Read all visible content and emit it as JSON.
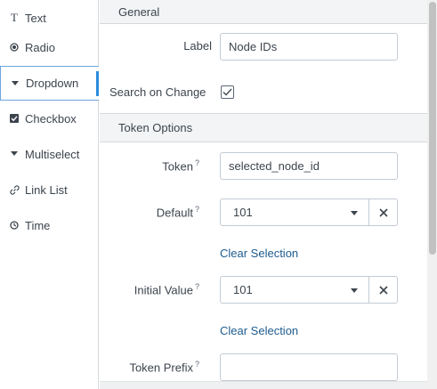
{
  "sidebar": {
    "items": [
      {
        "label": "Text",
        "icon": "text-icon"
      },
      {
        "label": "Radio",
        "icon": "radio-icon"
      },
      {
        "label": "Dropdown",
        "icon": "dropdown-icon",
        "active": true
      },
      {
        "label": "Checkbox",
        "icon": "checkbox-icon"
      },
      {
        "label": "Multiselect",
        "icon": "multiselect-icon"
      },
      {
        "label": "Link List",
        "icon": "link-icon"
      },
      {
        "label": "Time",
        "icon": "clock-icon"
      }
    ]
  },
  "general": {
    "header": "General",
    "label_label": "Label",
    "label_value": "Node IDs",
    "search_on_change_label": "Search on Change",
    "search_on_change_checked": true
  },
  "token_options": {
    "header": "Token Options",
    "token_label": "Token",
    "token_value": "selected_node_id",
    "help_mark": "?",
    "default_label": "Default",
    "default_value": "101",
    "clear_selection_1": "Clear Selection",
    "initial_value_label": "Initial Value",
    "initial_value": "101",
    "clear_selection_2": "Clear Selection",
    "token_prefix_label": "Token Prefix",
    "token_prefix_value": ""
  },
  "colors": {
    "accent": "#2c8cde",
    "link": "#1e5b8e",
    "section_bg": "#f2f4f5",
    "border": "#c3cbd4"
  }
}
